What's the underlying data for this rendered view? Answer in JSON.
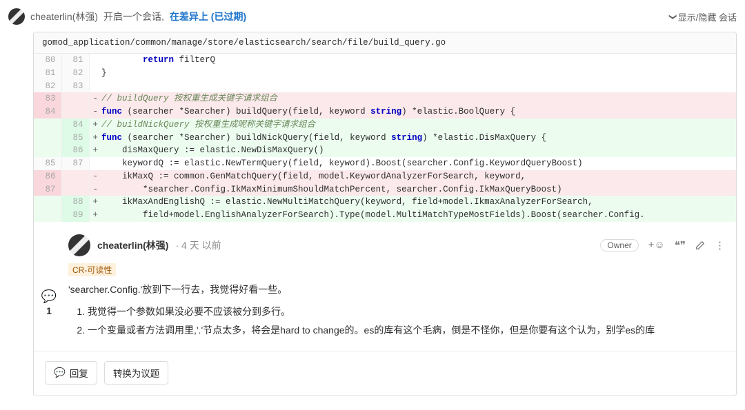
{
  "header": {
    "author": "cheaterlin(林强)",
    "opened": "开启一个会话,",
    "status": "在差异上 (已过期)",
    "toggle": "显示/隐藏 会话"
  },
  "file_path": "gomod_application/common/manage/store/elasticsearch/search/file/build_query.go",
  "diff": [
    {
      "t": "ctx",
      "o": "80",
      "n": "81",
      "s": "",
      "c": "        return filterQ"
    },
    {
      "t": "ctx",
      "o": "81",
      "n": "82",
      "s": "",
      "c": "}"
    },
    {
      "t": "ctx",
      "o": "82",
      "n": "83",
      "s": "",
      "c": ""
    },
    {
      "t": "del",
      "o": "83",
      "n": "",
      "s": "-",
      "c": "// buildQuery 按权重生成关键字请求组合",
      "style": "cm"
    },
    {
      "t": "del",
      "o": "84",
      "n": "",
      "s": "-",
      "c": "func (searcher *Searcher) buildQuery(field, keyword string) *elastic.BoolQuery {",
      "style": "sig1"
    },
    {
      "t": "add",
      "o": "",
      "n": "84",
      "s": "+",
      "c": "// buildNickQuery 按权重生成昵称关键字请求组合",
      "style": "cm"
    },
    {
      "t": "add",
      "o": "",
      "n": "85",
      "s": "+",
      "c": "func (searcher *Searcher) buildNickQuery(field, keyword string) *elastic.DisMaxQuery {",
      "style": "sig2"
    },
    {
      "t": "add",
      "o": "",
      "n": "86",
      "s": "+",
      "c": "    disMaxQuery := elastic.NewDisMaxQuery()"
    },
    {
      "t": "ctx",
      "o": "85",
      "n": "87",
      "s": "",
      "c": "    keywordQ := elastic.NewTermQuery(field, keyword).Boost(searcher.Config.KeywordQueryBoost)"
    },
    {
      "t": "del",
      "o": "86",
      "n": "",
      "s": "-",
      "c": "    ikMaxQ := common.GenMatchQuery(field, model.KeywordAnalyzerForSearch, keyword,"
    },
    {
      "t": "del",
      "o": "87",
      "n": "",
      "s": "-",
      "c": "        *searcher.Config.IkMaxMinimumShouldMatchPercent, searcher.Config.IkMaxQueryBoost)"
    },
    {
      "t": "add",
      "o": "",
      "n": "88",
      "s": "+",
      "c": "    ikMaxAndEnglishQ := elastic.NewMultiMatchQuery(keyword, field+model.IkmaxAnalyzerForSearch,"
    },
    {
      "t": "add",
      "o": "",
      "n": "89",
      "s": "+",
      "c": "        field+model.EnglishAnalyzerForSearch).Type(model.MultiMatchTypeMostFields).Boost(searcher.Config."
    }
  ],
  "note": {
    "author": "cheaterlin(林强)",
    "time": "4 天 以前",
    "owner": "Owner",
    "tag": "CR-可读性",
    "line": "'searcher.Config.'放到下一行去，我觉得好看一些。",
    "ol1": "我觉得一个参数如果没必要不应该被分到多行。",
    "ol2": "一个变量或者方法调用里,'.'节点太多，将会是hard to change的。es的库有这个毛病，倒是不怪你，但是你要有这个认为，别学es的库"
  },
  "count": "1",
  "buttons": {
    "reply": "回复",
    "convert": "转换为议题"
  }
}
